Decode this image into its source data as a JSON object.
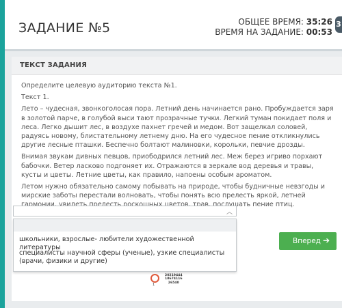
{
  "header": {
    "title": "ЗАДАНИЕ №5",
    "total_time_label": "ОБЩЕЕ ВРЕМЯ:",
    "total_time_value": "35:26",
    "task_time_label": "ВРЕМЯ НА ЗАДАНИЕ:",
    "task_time_value": "00:53",
    "corner_button_label": "3"
  },
  "task": {
    "header": "ТЕКСТ ЗАДАНИЯ",
    "question": "Определите целевую аудиторию текста №1.",
    "text_label": "Текст 1.",
    "paragraphs": [
      "Лето – чудесная, звонкоголосая пора. Летний день начинается рано. Пробуждается заря в золотой парче, в голубой выси тают прозрачные тучки. Легкий туман покидает поля и леса. Легко дышит лес, в воздухе пахнет гречей и медом. Вот защелкал соловей, радуясь новому, блистательному летнему дню. На его чудесное пение откликнулись другие лесные пташки. Беспечно болтают малиновки, корольки, певчие дрозды.",
      "Внимая звукам дивных певцов, приободрился летний лес. Меж берез игриво порхают бабочки. Ветер ласково подгоняет их. Отражаются в зеркале вод деревья и травы, кусты и цветы. Летние цветы, как правило, напоены особым ароматом.",
      "Летом нужно обязательно самому побывать на природе, чтобы будничные невзгоды и мирские заботы перестали волновать, чтобы понять всю прелесть яркой, летней гармонии, увидеть прелесть роскошных цветов, трав, послушать пение птиц."
    ]
  },
  "answer_select": {
    "selected_value": "",
    "options": [
      "",
      "школьники, взрослые- любители художественной литературы",
      "специалисты научной сферы (ученые), узкие специалисты (врачи, физики и другие)"
    ]
  },
  "next_button": {
    "label": "Вперед",
    "arrow": "➔"
  },
  "footer_marks": {
    "small_number": "1",
    "stack_lines": [
      "20219444",
      "18674116",
      "26540"
    ]
  },
  "colors": {
    "accent": "#1ba39c",
    "next_button": "#4caf50",
    "ring": "#e05a3c"
  }
}
